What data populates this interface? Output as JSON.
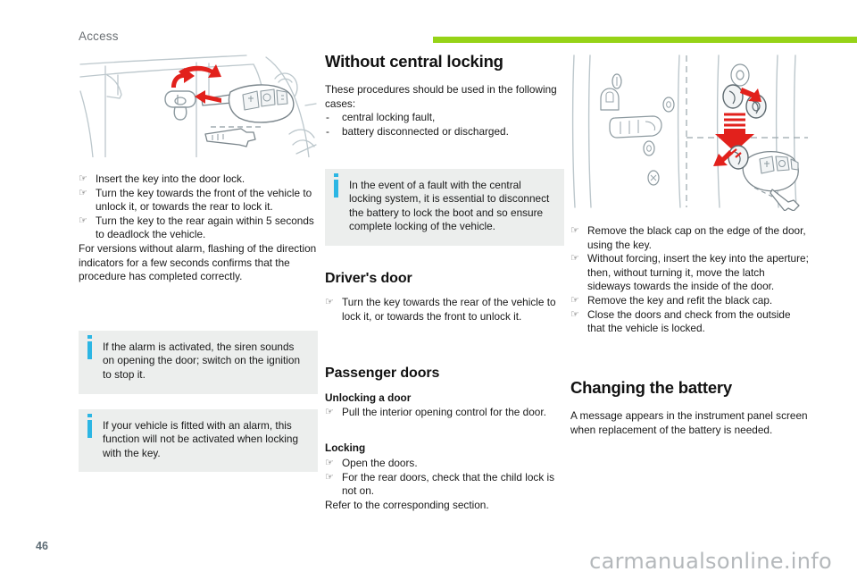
{
  "header": {
    "chapter": "Access",
    "rule_color": "#96d317"
  },
  "footer": {
    "page_number": "46",
    "watermark": "carmanualsonline.info"
  },
  "icons": {
    "hand_bullet": "☞",
    "dash_bullet": "-",
    "info_mark": "i"
  },
  "colors": {
    "accent_green": "#96d317",
    "info_blue": "#2cb6e4",
    "note_background": "#eceeed",
    "arrow_red": "#e2211c",
    "line_art": "#b9c4c9"
  },
  "left_column": {
    "illustration": {
      "name": "door-lock-key-insert-illustration",
      "caption": "Line drawing of a car door lock with the key being inserted and turned, red arrows showing rotation"
    },
    "steps": [
      "Insert the key into the door lock.",
      "Turn the key towards the front of the vehicle to unlock it, or towards the rear to lock it.",
      "Turn the key to the rear again within 5 seconds to deadlock the vehicle."
    ],
    "paragraph": "For versions without alarm, flashing of the direction indicators for a few seconds confirms that the procedure has completed correctly.",
    "notes": [
      "If the alarm is activated, the siren sounds on opening the door; switch on the ignition to stop it.",
      "If your vehicle is fitted with an alarm, this function will not be activated when locking with the key."
    ]
  },
  "middle_column": {
    "title": "Without central locking",
    "intro": "These procedures should be used in the following cases:",
    "cases": [
      "central locking fault,",
      "battery disconnected or discharged."
    ],
    "note": "In the event of a fault with the central locking system, it is essential to disconnect the battery to lock the boot and so ensure complete locking of the vehicle.",
    "drivers_door": {
      "title": "Driver's door",
      "steps": [
        "Turn the key towards the rear of the vehicle to lock it, or towards the front to unlock it."
      ]
    },
    "passenger_doors": {
      "title": "Passenger doors",
      "unlocking": {
        "title": "Unlocking a door",
        "steps": [
          "Pull the interior opening control for the door."
        ]
      },
      "locking": {
        "title": "Locking",
        "steps": [
          "Open the doors.",
          "For the rear doors, check that the child lock is not on."
        ],
        "closing_text": "Refer to the corresponding section."
      }
    }
  },
  "right_column": {
    "illustration": {
      "name": "door-edge-latch-black-cap-illustration",
      "caption": "Line drawing of the door edge showing the black cap, the latch and the key, with red arrows indicating removal and insertion"
    },
    "steps": [
      "Remove the black cap on the edge of the door, using the key.",
      "Without forcing, insert the key into the aperture; then, without turning it, move the latch sideways towards the inside of the door.",
      "Remove the key and refit the black cap.",
      "Close the doors and check from the outside that the vehicle is locked."
    ],
    "changing_battery": {
      "title": "Changing the battery",
      "paragraph": "A message appears in the instrument panel screen when replacement of the battery is needed."
    }
  }
}
